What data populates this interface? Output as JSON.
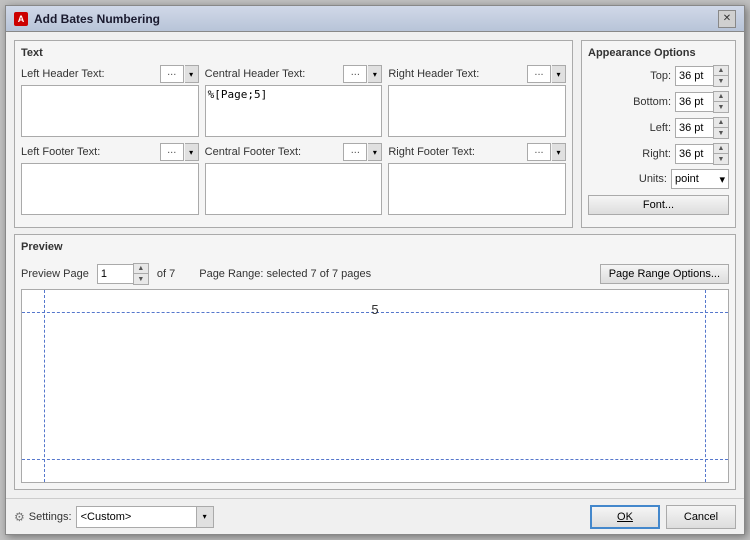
{
  "dialog": {
    "title": "Add Bates Numbering",
    "close_label": "✕"
  },
  "text_section": {
    "label": "Text",
    "left_header": {
      "label": "Left Header Text:",
      "ellipsis": "...",
      "value": ""
    },
    "central_header": {
      "label": "Central Header Text:",
      "ellipsis": "...",
      "value": "%[Page;5]"
    },
    "right_header": {
      "label": "Right Header Text:",
      "ellipsis": "...",
      "value": ""
    },
    "left_footer": {
      "label": "Left Footer Text:",
      "ellipsis": "...",
      "value": ""
    },
    "central_footer": {
      "label": "Central Footer Text:",
      "ellipsis": "...",
      "value": ""
    },
    "right_footer": {
      "label": "Right Footer Text:",
      "ellipsis": "...",
      "value": ""
    }
  },
  "appearance": {
    "label": "Appearance Options",
    "top_label": "Top:",
    "top_value": "36 pt",
    "bottom_label": "Bottom:",
    "bottom_value": "36 pt",
    "left_label": "Left:",
    "left_value": "36 pt",
    "right_label": "Right:",
    "right_value": "36 pt",
    "units_label": "Units:",
    "units_value": "point",
    "font_label": "Font..."
  },
  "preview": {
    "label": "Preview",
    "page_label": "Preview Page",
    "page_value": "1",
    "of_text": "of 7",
    "page_range_label": "Page Range: selected 7 of 7 pages",
    "page_range_btn": "Page Range Options...",
    "number_display": "5"
  },
  "footer": {
    "settings_icon": "⚙",
    "settings_label": "Settings:",
    "settings_value": "<Custom>",
    "ok_label": "OK",
    "cancel_label": "Cancel"
  }
}
